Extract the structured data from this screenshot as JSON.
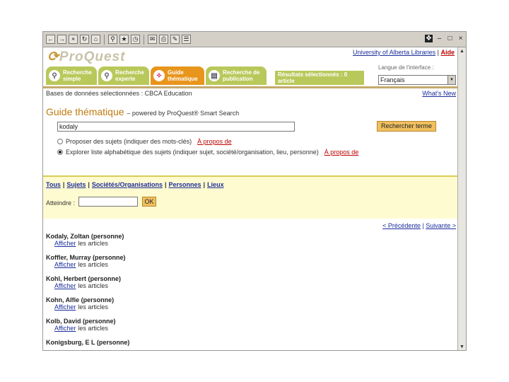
{
  "toolbar": {
    "icons": [
      "back-arrow",
      "forward-arrow",
      "stop",
      "refresh",
      "home",
      "search",
      "favorites",
      "history",
      "mail",
      "print",
      "edit",
      "discuss"
    ]
  },
  "header": {
    "logo": "ProQuest",
    "university_link": "University of Alberta Libraries",
    "separator": "|",
    "aide_link": "Aide"
  },
  "tabs": [
    {
      "label": "Recherche simple"
    },
    {
      "label": "Recherche experte"
    },
    {
      "label": "Guide thématique"
    },
    {
      "label": "Recherche de publication"
    }
  ],
  "selected_results": "Résultats sélectionnés : 0 article",
  "language": {
    "label": "Langue de l'interface :",
    "value": "Français"
  },
  "databases": "Bases de données sélectionnées : CBCA Education",
  "whats_new": "What's New",
  "title": "Guide thématique",
  "subtitle": "– powered by ProQuest® Smart Search",
  "search": {
    "value": "kodaly",
    "button": "Rechercher terme"
  },
  "options": [
    {
      "label": "Proposer des sujets (indiquer des mots-clés)",
      "link": "À propos de",
      "checked": false
    },
    {
      "label": "Explorer liste alphabétique des sujets (indiquer sujet, société/organisation, lieu, personne)",
      "link": "À propos de",
      "checked": true
    }
  ],
  "filters": [
    "Tous",
    "Sujets",
    "Sociétés/Organisations",
    "Personnes",
    "Lieux"
  ],
  "attendre": {
    "label": "Atteindre :",
    "ok": "OK"
  },
  "pager": {
    "prev": "< Précédente",
    "next": "Suivante >"
  },
  "results": [
    {
      "name": "Kodaly, Zoltan (personne)",
      "link": "Afficher",
      "rest": "les articles"
    },
    {
      "name": "Koffler, Murray (personne)",
      "link": "Afficher",
      "rest": "les articles"
    },
    {
      "name": "Kohl, Herbert (personne)",
      "link": "Afficher",
      "rest": "les articles"
    },
    {
      "name": "Kohn, Alfie (personne)",
      "link": "Afficher",
      "rest": "les articles"
    },
    {
      "name": "Kolb, David (personne)",
      "link": "Afficher",
      "rest": "les articles"
    },
    {
      "name": "Konigsburg, E L (personne)",
      "link": "",
      "rest": ""
    }
  ]
}
